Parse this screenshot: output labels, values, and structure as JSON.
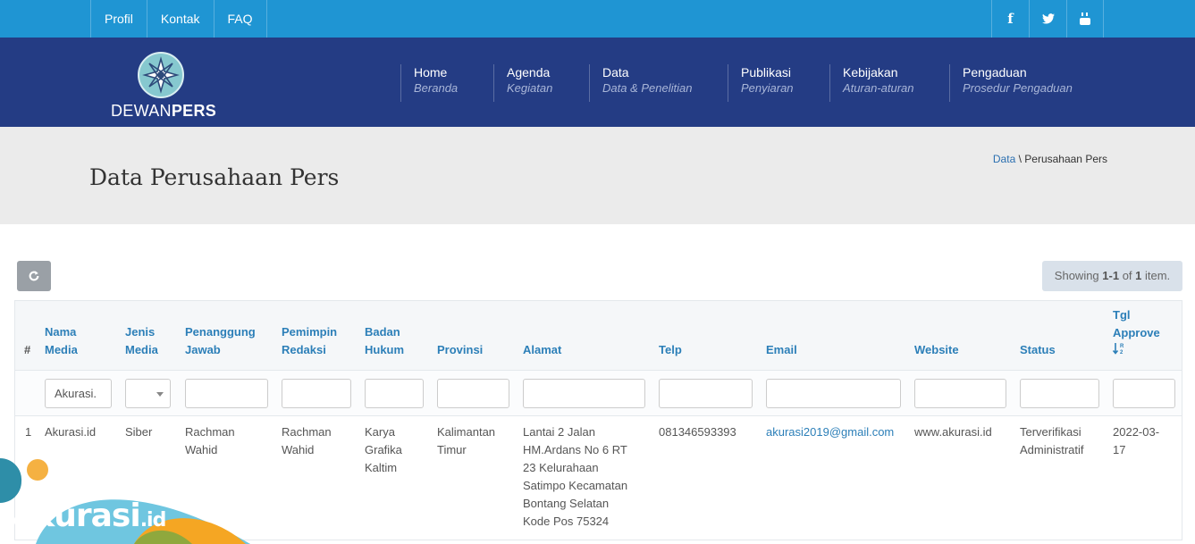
{
  "topbar": {
    "links": [
      "Profil",
      "Kontak",
      "FAQ"
    ],
    "social": [
      {
        "icon": "facebook-icon",
        "glyph": "f"
      },
      {
        "icon": "twitter-icon",
        "glyph": "t"
      },
      {
        "icon": "youtube-icon",
        "glyph": "▶"
      }
    ]
  },
  "logo": {
    "text_light": "DEWAN",
    "text_bold": "PERS"
  },
  "nav": [
    {
      "title": "Home",
      "sub": "Beranda"
    },
    {
      "title": "Agenda",
      "sub": "Kegiatan"
    },
    {
      "title": "Data",
      "sub": "Data & Penelitian"
    },
    {
      "title": "Publikasi",
      "sub": "Penyiaran"
    },
    {
      "title": "Kebijakan",
      "sub": "Aturan-aturan"
    },
    {
      "title": "Pengaduan",
      "sub": "Prosedur Pengaduan"
    }
  ],
  "page": {
    "title": "Data Perusahaan Pers",
    "breadcrumb_link": "Data",
    "breadcrumb_sep": " \\ ",
    "breadcrumb_current": "Perusahaan Pers"
  },
  "toolbar": {
    "refresh_icon": "refresh-icon",
    "summary_prefix": "Showing ",
    "summary_range": "1-1",
    "summary_mid": " of ",
    "summary_total": "1",
    "summary_suffix": " item."
  },
  "table": {
    "columns": [
      {
        "key": "num",
        "label": [
          "#"
        ]
      },
      {
        "key": "nama",
        "label": [
          "Nama",
          "Media"
        ]
      },
      {
        "key": "jenis",
        "label": [
          "Jenis",
          "Media"
        ]
      },
      {
        "key": "pj",
        "label": [
          "Penanggung",
          "Jawab"
        ]
      },
      {
        "key": "pr",
        "label": [
          "Pemimpin",
          "Redaksi"
        ]
      },
      {
        "key": "bh",
        "label": [
          "Badan",
          "Hukum"
        ]
      },
      {
        "key": "prov",
        "label": [
          "Provinsi"
        ]
      },
      {
        "key": "alamat",
        "label": [
          "Alamat"
        ]
      },
      {
        "key": "telp",
        "label": [
          "Telp"
        ]
      },
      {
        "key": "email",
        "label": [
          "Email"
        ]
      },
      {
        "key": "web",
        "label": [
          "Website"
        ]
      },
      {
        "key": "status",
        "label": [
          "Status"
        ]
      },
      {
        "key": "tgl",
        "label": [
          "Tgl",
          "Approve"
        ]
      }
    ],
    "filter_values": {
      "nama": "Akurasi.",
      "jenis": "",
      "pj": "",
      "pr": "",
      "bh": "",
      "prov": "",
      "alamat": "",
      "telp": "",
      "email": "",
      "web": "",
      "status": "",
      "tgl": ""
    },
    "rows": [
      {
        "num": "1",
        "nama": [
          "Akurasi.id"
        ],
        "jenis": [
          "Siber"
        ],
        "pj": [
          "Rachman",
          "Wahid"
        ],
        "pr": [
          "Rachman",
          "Wahid"
        ],
        "bh": [
          "Karya",
          "Grafika",
          "Kaltim"
        ],
        "prov": [
          "Kalimantan",
          "Timur"
        ],
        "alamat": [
          "Lantai 2 Jalan",
          "HM.Ardans No 6 RT",
          "23 Kelurahaan",
          "Satimpo Kecamatan",
          "Bontang Selatan",
          "Kode Pos 75324"
        ],
        "telp": [
          "081346593393"
        ],
        "email": [
          "akurasi2019@gmail.com"
        ],
        "web": [
          "www.akurasi.id"
        ],
        "status": [
          "Terverifikasi",
          "Administratif"
        ],
        "tgl": [
          "2022-03-",
          "17"
        ]
      }
    ]
  },
  "watermark": {
    "text": "akurasi",
    "suffix": ".id"
  },
  "colors": {
    "topbar": "#1f95d3",
    "navbar": "#243c84",
    "header_band": "#ebebeb",
    "link": "#2c7fb8"
  }
}
